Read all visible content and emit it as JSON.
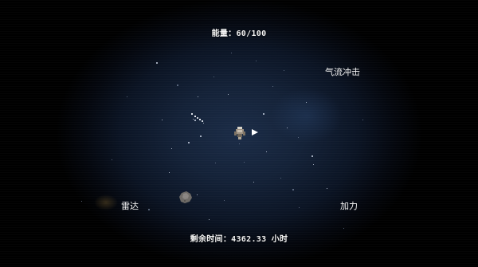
{
  "hud": {
    "energy_label": "能量",
    "energy_current": 60,
    "energy_max": 100,
    "energy_text": "能量：60/100",
    "time_text": "剩余时间：4362.33 小时"
  },
  "skills": {
    "airflow": "气流冲击",
    "radar": "雷达",
    "boost": "加力"
  },
  "colors": {
    "background": "#000000",
    "space_center": "#1b2c47",
    "text": "#f5f5f5",
    "star": "#cfd8e8"
  },
  "icons": {
    "ship": "spaceship-icon",
    "direction": "direction-arrow-icon",
    "asteroid": "asteroid-icon"
  }
}
